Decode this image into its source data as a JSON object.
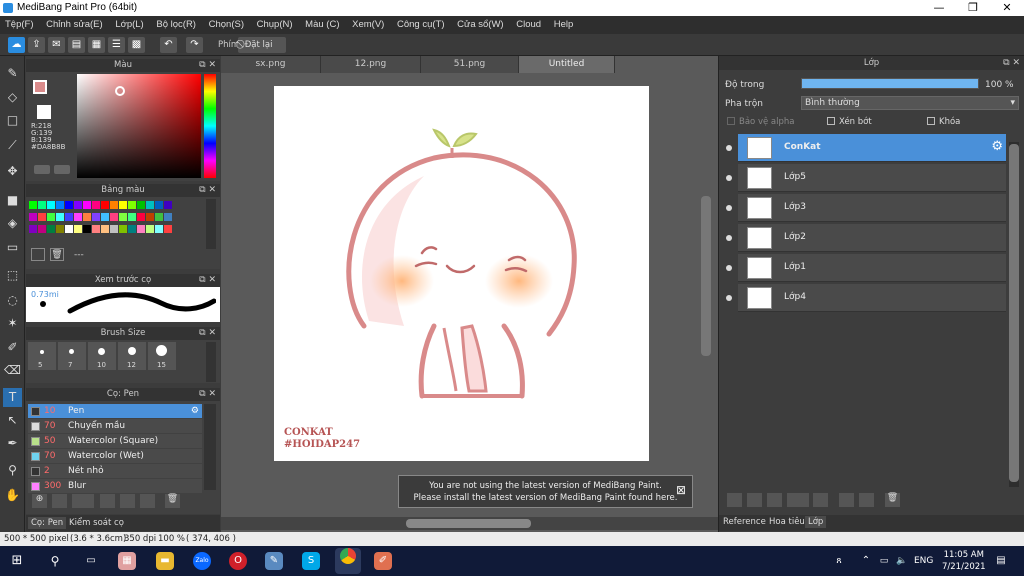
{
  "window": {
    "title": "MediBang Paint Pro (64bit)",
    "minimize": "—",
    "restore": "❐",
    "close": "✕"
  },
  "menu": [
    "Tệp(F)",
    "Chỉnh sửa(E)",
    "Lớp(L)",
    "Bộ lọc(R)",
    "Chọn(S)",
    "Chụp(N)",
    "Màu (C)",
    "Xem(V)",
    "Công cụ(T)",
    "Cửa sổ(W)",
    "Cloud",
    "Help"
  ],
  "toolbar": {
    "key_label": "Phím",
    "reset_label": "Đặt lại"
  },
  "color_panel": {
    "title": "Màu",
    "r": "R:218",
    "g": "G:139",
    "b": "B:139",
    "hex": "#DA8B8B",
    "fg_color": "#DA8B8B"
  },
  "palette_panel": {
    "title": "Bảng màu",
    "dash": "---"
  },
  "palette_colors": [
    "#00ff00",
    "#00ff80",
    "#00ffff",
    "#0080ff",
    "#0000ff",
    "#8000ff",
    "#ff00ff",
    "#ff0080",
    "#ff0000",
    "#ff8000",
    "#ffff00",
    "#80ff00",
    "#00c000",
    "#00c0c0",
    "#0060c0",
    "#4000c0",
    "#c000c0",
    "#ff4040",
    "#40ff40",
    "#40ffff",
    "#4040ff",
    "#ff40ff",
    "#ff8040",
    "#8040ff",
    "#40c0ff",
    "#ff4080",
    "#80ff40",
    "#40ff80",
    "#ff0040",
    "#c04000",
    "#40c040",
    "#4080c0",
    "#8000c0",
    "#c00080",
    "#008040",
    "#808000",
    "#ffffff",
    "#ffff80",
    "#000000",
    "#ff8080",
    "#ffc080",
    "#c0c0c0",
    "#80c000",
    "#008080",
    "#ff80c0",
    "#c0ff80",
    "#80ffff",
    "#ff4040"
  ],
  "preview_panel": {
    "title": "Xem trước cọ",
    "size": "0.73mi"
  },
  "brush_size_panel": {
    "title": "Brush Size",
    "sizes": [
      "5",
      "7",
      "10",
      "12",
      "15"
    ]
  },
  "brush_panel": {
    "title": "Cọ: Pen",
    "brushes": [
      {
        "size": "10",
        "name": "Pen",
        "color": "#333333"
      },
      {
        "size": "70",
        "name": "Chuyển mầu",
        "color": "#dddddd"
      },
      {
        "size": "50",
        "name": "Watercolor (Square)",
        "color": "#b8e08a"
      },
      {
        "size": "70",
        "name": "Watercolor (Wet)",
        "color": "#6fd3f0"
      },
      {
        "size": "2",
        "name": "Nét nhỏ",
        "color": "#333333"
      },
      {
        "size": "300",
        "name": "Blur",
        "color": "#ff80ff"
      }
    ]
  },
  "left_tabs": [
    "Cọ: Pen",
    "Kiểm soát cọ"
  ],
  "doc_tabs": [
    "sx.png",
    "12.png",
    "51.png",
    "Untitled"
  ],
  "canvas": {
    "text_line1": "CONKAT",
    "text_line2": "#HOIDAP247"
  },
  "notice": {
    "line1": "You are not using the latest version of MediBang Paint.",
    "line2": "Please install the latest version of MediBang Paint found here.",
    "close": "⊠"
  },
  "layer_panel": {
    "title": "Lớp",
    "opacity_label": "Độ trong",
    "opacity_value": "100 %",
    "opacity": 1.0,
    "blend_label": "Pha trộn",
    "blend_value": "Bình thường",
    "protect_alpha": "Bảo vệ alpha",
    "clip": "Xén bớt",
    "lock": "Khóa",
    "layers": [
      "ConKat",
      "Lớp5",
      "Lớp3",
      "Lớp2",
      "Lớp1",
      "Lớp4"
    ]
  },
  "right_tabs": [
    "Reference",
    "Hoa tiêu",
    "Lớp"
  ],
  "status": {
    "size": "500 * 500 pixel",
    "cm": "(3.6 * 3.6cm)",
    "dpi": "350 dpi",
    "zoom": "100 %",
    "coords": "( 374, 406 )"
  },
  "taskbar": {
    "time": "11:05 AM",
    "date": "7/21/2021",
    "lang": "ENG"
  }
}
